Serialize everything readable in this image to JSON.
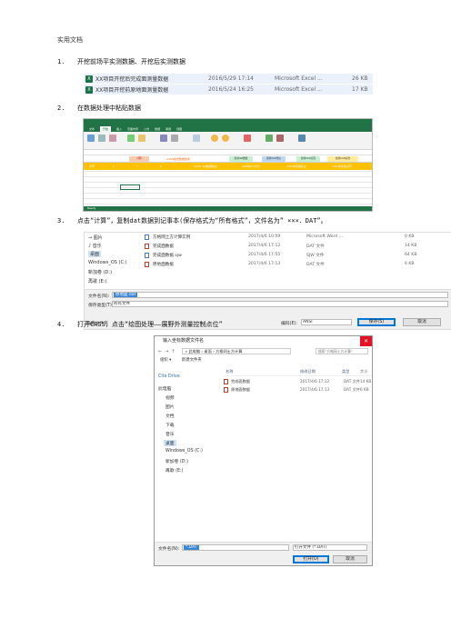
{
  "header": "实用文档",
  "steps": [
    {
      "num": "1.",
      "text": "开挖前场平实测数据、开挖后实测数据"
    },
    {
      "num": "2.",
      "text": "在数据处理中粘贴数据"
    },
    {
      "num": "3.",
      "text": "点击“计算”，复制dat数据到记事本(保存格式为“所有格式”，文件名为” ×××．DAT”。"
    },
    {
      "num": "4.",
      "text": "打开CASS，点击“绘图处理——展野外测量控制点位”"
    }
  ],
  "shot1": {
    "files": [
      {
        "name": "XX项目开挖后完成面测量数据",
        "date": "2016/5/29 17:14",
        "type": "Microsoft Excel ...",
        "size": "26 KB"
      },
      {
        "name": "XX项目开挖前原地面测量数据",
        "date": "2016/5/24 16:25",
        "type": "Microsoft Excel ...",
        "size": "17 KB"
      }
    ]
  },
  "shot2": {
    "ribbon_tabs": [
      "文件",
      "开始",
      "插入",
      "页面布局",
      "公式",
      "数据",
      "审阅",
      "视图"
    ],
    "header_cells": [
      "计算",
      "CASS格式数据生成",
      "点号",
      "X",
      "Y",
      "H",
      "CASS dat数据格式",
      "CAD中X/Y点位",
      "CAD中高程标注",
      "CAD中标准点号"
    ],
    "pills": [
      "复制dat数据",
      "复制CAD坐标",
      "复制CAD高程",
      "复制CAD标准"
    ],
    "status": "Ready",
    "colors": {
      "excel_green": "#217346",
      "yellow": "#ffc000"
    }
  },
  "shot3": {
    "nav": [
      "→ 图片",
      "♪ 音乐",
      "桌面",
      "Windows_OS (C:)",
      "新加卷 (D:)",
      "再歌 (E:)"
    ],
    "files": [
      {
        "name": "方格网土方计算实例",
        "date": "2017/4/6 10:09",
        "type": "Microsoft Word ...",
        "size": "0 KB"
      },
      {
        "name": "完成面数据",
        "date": "2017/4/6 17:12",
        "type": "DAT 文件",
        "size": "14 KB"
      },
      {
        "name": "完成面数据.sjw",
        "date": "2017/4/6 17:55",
        "type": "SJW 文件",
        "size": "64 KB"
      },
      {
        "name": "原地面数据",
        "date": "2017/4/6 17:13",
        "type": "DAT 文件",
        "size": "6 KB"
      }
    ],
    "filename_label": "文件名(N):",
    "filename_value": "原地面.dat",
    "savetype_label": "保存类型(T):",
    "savetype_value": "所有文件",
    "hide_folders": "隐藏文件夹",
    "encoding_label": "编码(E):",
    "encoding_value": "ANSI",
    "save_btn": "保存(S)",
    "cancel_btn": "取消"
  },
  "shot4": {
    "title": "输入坐标数据文件名",
    "close": "✕",
    "breadcrumb": "« 此电脑 › 桌面 › 方格网土方计算",
    "search_placeholder": "搜索\"方格网土方计算\"",
    "organize": "组织 ▾",
    "new_folder": "新建文件夹",
    "sidebar": [
      "Cite Drive",
      "此电脑",
      "视频",
      "图片",
      "文档",
      "下载",
      "音乐",
      "桌面",
      "Windows_OS (C:)",
      "新加卷 (D:)",
      "再歌 (E:)"
    ],
    "columns": [
      "名称",
      "修改日期",
      "类型",
      "大小"
    ],
    "files": [
      {
        "name": "完成面数据",
        "date": "2017/4/6 17:12",
        "type": "DAT 文件",
        "size": "14 KB"
      },
      {
        "name": "原地面数据",
        "date": "2017/4/6 17:13",
        "type": "DAT 文件",
        "size": "6 KB"
      }
    ],
    "filename_label": "文件名(N):",
    "filename_value": "*.DAT",
    "filter_value": "打开文件 (*.DAT)",
    "open_btn": "打开(O)",
    "cancel_btn": "取消"
  }
}
